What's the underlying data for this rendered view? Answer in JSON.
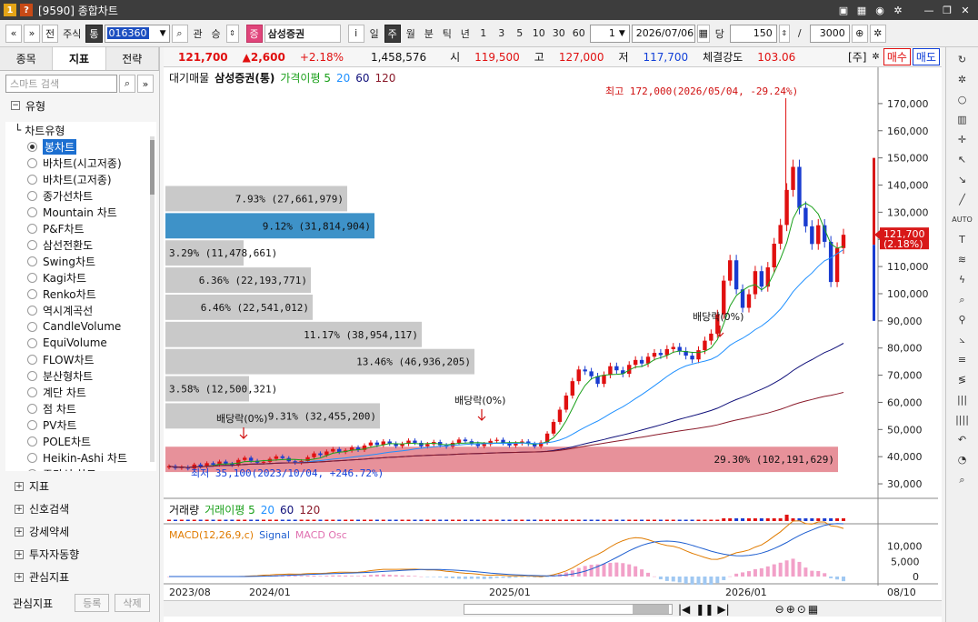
{
  "window": {
    "title": "[9590] 종합차트",
    "title_icons": [
      "1",
      "?"
    ],
    "controls": [
      "save-icon",
      "grid-icon",
      "camera-icon",
      "gear-icon",
      "minimize-icon",
      "restore-icon",
      "close-icon"
    ]
  },
  "toolbar": {
    "nav_prev": "«",
    "nav_next": "»",
    "btn_all": "전",
    "market": "주식",
    "market_flag": "통",
    "code": "016360",
    "search": "⌕",
    "btn_gwan": "관",
    "btn_sung": "승",
    "badge_jeung": "증",
    "stock_name": "삼성증권",
    "btn_info": "i",
    "periods": [
      "일",
      "주",
      "월",
      "분",
      "틱",
      "년"
    ],
    "period_selected": "주",
    "intervals": [
      "1",
      "3",
      "5",
      "10",
      "30",
      "60"
    ],
    "count_select": "1",
    "date": "2026/07/06",
    "btn_dang": "당",
    "count_value": "150",
    "slash": "/",
    "total_value": "3000"
  },
  "left_panel": {
    "tabs": [
      "종목",
      "지표",
      "전략"
    ],
    "active_tab": "지표",
    "search_placeholder": "스마트 검색",
    "section_title": "유형",
    "tree_parent": "차트유형",
    "chart_types": [
      "봉차트",
      "바차트(시고저종)",
      "바차트(고저종)",
      "종가선차트",
      "Mountain 차트",
      "P&F차트",
      "삼선전환도",
      "Swing차트",
      "Kagi차트",
      "Renko차트",
      "역시계곡선",
      "CandleVolume",
      "EquiVolume",
      "FLOW차트",
      "분산형차트",
      "계단 차트",
      "점 차트",
      "PV차트",
      "POLE차트",
      "Heikin-Ashi 차트",
      "주가선 차트"
    ],
    "selected_type": "봉차트",
    "groups": [
      "지표",
      "신호검색",
      "강세약세",
      "투자자동향",
      "관심지표"
    ],
    "footer_label": "관심지표",
    "footer_register": "등록",
    "footer_delete": "삭제"
  },
  "quote_bar": {
    "price": "121,700",
    "change": "▲2,600",
    "change_pct": "+2.18%",
    "volume": "1,458,576",
    "open_label": "시",
    "open": "119,500",
    "high_label": "고",
    "high": "127,000",
    "low_label": "저",
    "low": "117,700",
    "strength_label": "체결강도",
    "strength": "103.06",
    "unit": "[주]",
    "buy": "매수",
    "sell": "매도"
  },
  "price_legend": {
    "items": [
      "대기매물",
      "삼성증권(통)",
      "가격이평 5",
      "20",
      "60",
      "120"
    ]
  },
  "colors": {
    "up": "#e01010",
    "down": "#1a3cd0",
    "ma5": "#1aa01a",
    "ma20": "#1f90ff",
    "ma60": "#10107a",
    "ma120": "#8a1a2a",
    "bar_gray": "#c9c9c9",
    "bar_blue": "#3e92c8",
    "bar_pink": "#e7919a"
  },
  "volume_profile": [
    {
      "label": "7.93% (27,661,979)"
    },
    {
      "label": "9.12% (31,814,904)"
    },
    {
      "label": "3.29% (11,478,661)"
    },
    {
      "label": "6.36% (22,193,771)"
    },
    {
      "label": "6.46% (22,541,012)"
    },
    {
      "label": "11.17% (38,954,117)"
    },
    {
      "label": "13.46% (46,936,205)"
    },
    {
      "label": "3.58% (12,500,321)"
    },
    {
      "label": "9.31% (32,455,200)"
    },
    {
      "label": "29.30% (102,191,629)"
    }
  ],
  "annotations": {
    "high": "최고 172,000(2026/05/04, -29.24%)",
    "low": "최저 35,100(2023/10/04, +246.72%)",
    "dividend": "배당락(0%)"
  },
  "price_axis": [
    "170,000",
    "160,000",
    "150,000",
    "140,000",
    "130,000",
    "120,000",
    "110,000",
    "100,000",
    "90,000",
    "80,000",
    "70,000",
    "60,000",
    "50,000",
    "40,000",
    "30,000"
  ],
  "price_tag": {
    "price": "121,700",
    "pct": "(2.18%)"
  },
  "volume_legend": {
    "items": [
      "거래량",
      "거래이평 5",
      "20",
      "60",
      "120"
    ]
  },
  "macd_legend": {
    "items": [
      "MACD(12,26,9,c)",
      "Signal",
      "MACD Osc"
    ]
  },
  "macd_axis": [
    "10,000",
    "5,000",
    "0"
  ],
  "date_axis": [
    "2023/08",
    "2024/01",
    "2025/01",
    "2026/01",
    "08/10"
  ],
  "chart_data": {
    "type": "candlestick",
    "xlabel": "",
    "ylabel": "",
    "ylim": [
      26000,
      178000
    ],
    "candles_weekly_close": [
      36500,
      35800,
      36200,
      35600,
      37100,
      36300,
      37600,
      37000,
      38200,
      37400,
      36900,
      38800,
      39600,
      38500,
      37800,
      38100,
      39200,
      40100,
      39500,
      38300,
      37700,
      38400,
      39800,
      41200,
      40600,
      41900,
      42800,
      41700,
      42300,
      43400,
      42500,
      44100,
      45200,
      44300,
      45600,
      44800,
      43900,
      44700,
      45900,
      45100,
      43800,
      44600,
      45400,
      44200,
      43700,
      45100,
      46300,
      45700,
      44800,
      43900,
      44600,
      45800,
      46200,
      45000,
      44100,
      44900,
      45600,
      44700,
      43800,
      45200,
      48500,
      52800,
      57300,
      62500,
      67800,
      72100,
      71400,
      69600,
      66800,
      70100,
      73300,
      71800,
      70500,
      73800,
      75600,
      74300,
      76800,
      78200,
      77400,
      79600,
      80400,
      78900,
      77200,
      75800,
      79200,
      82700,
      85300,
      92400,
      104800,
      112300,
      101600,
      94800,
      99800,
      108300,
      102600,
      109700,
      118400,
      125300,
      138200,
      146700,
      131600,
      124800,
      118300,
      125200,
      119100,
      104300,
      116800,
      121700
    ]
  }
}
